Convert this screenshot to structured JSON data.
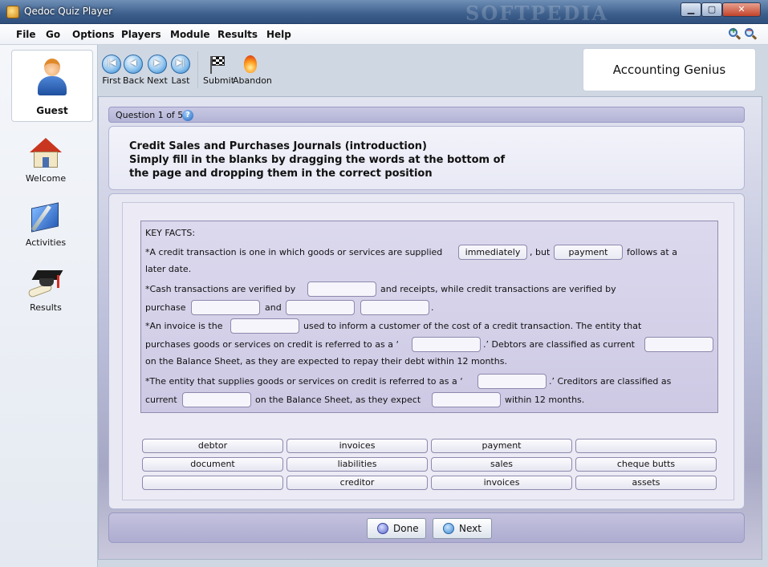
{
  "window": {
    "title": "Qedoc Quiz Player",
    "watermark": "SOFTPEDIA",
    "min": "▁",
    "max": "▢",
    "close": "✕"
  },
  "menu": [
    "File",
    "Go",
    "Options",
    "Players",
    "Module",
    "Results",
    "Help"
  ],
  "sidebar": {
    "user": "Guest",
    "items": [
      {
        "label": "Welcome",
        "icon": "house-icon"
      },
      {
        "label": "Activities",
        "icon": "book-icon"
      },
      {
        "label": "Results",
        "icon": "graduation-cap-icon"
      }
    ]
  },
  "toolbar": {
    "first": "First",
    "back": "Back",
    "next": "Next",
    "last": "Last",
    "submit": "Submit",
    "abandon": "Abandon",
    "quiz_title": "Accounting Genius"
  },
  "question": {
    "counter": "Question 1 of 5.",
    "help": "?",
    "instructions": "Credit Sales and Purchases Journals (introduction)\nSimply fill in the blanks by dragging the words at the bottom of\nthe page and dropping them in the correct position"
  },
  "facts": {
    "heading": "KEY FACTS:",
    "l1a": "*A credit transaction is one in which goods or services are supplied",
    "l1b": ", but",
    "l1c": "follows at a",
    "l2": "later date.",
    "l3a": "*Cash transactions are verified by",
    "l3b": "and receipts, while credit transactions are verified by",
    "l4a": "purchase",
    "l4b": "and",
    "l4c": ".",
    "l5a": "*An invoice is the",
    "l5b": "used to inform a customer of the cost of a credit transaction. The entity that",
    "l6a": "purchases goods or services on credit is referred to as a ‘",
    "l6b": ".’ Debtors are classified as current",
    "l7": "on the Balance Sheet, as they are expected to repay their debt within 12 months.",
    "l8a": "*The entity that supplies goods or services on credit is referred to as a ‘",
    "l8b": ".’ Creditors are classified as",
    "l9a": "current",
    "l9b": "on the Balance Sheet, as they expect",
    "l9c": "within 12 months.",
    "filled1": "immediately",
    "filled2": "payment"
  },
  "word_bank": [
    [
      "debtor",
      "invoices",
      "payment",
      ""
    ],
    [
      "document",
      "liabilities",
      "sales",
      "cheque butts"
    ],
    [
      "",
      "creditor",
      "invoices",
      "assets"
    ]
  ],
  "footer": {
    "done": "Done",
    "next": "Next"
  }
}
